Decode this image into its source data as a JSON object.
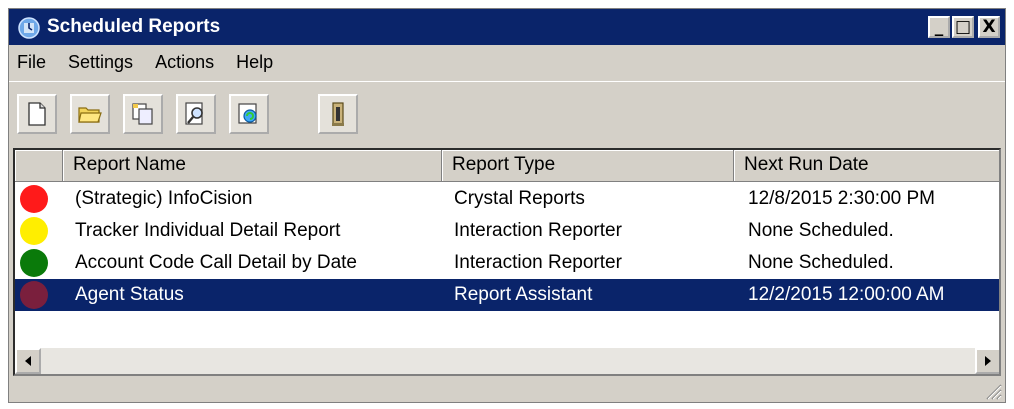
{
  "window": {
    "title": "Scheduled Reports",
    "buttons": {
      "minimize": "_",
      "maximize": "□",
      "close": "X"
    }
  },
  "menu": [
    "File",
    "Settings",
    "Actions",
    "Help"
  ],
  "toolbar": {
    "buttons": [
      {
        "icon": "new-document-icon"
      },
      {
        "icon": "open-folder-icon"
      },
      {
        "icon": "copy-icon"
      },
      {
        "icon": "find-icon"
      },
      {
        "icon": "refresh-icon"
      },
      {
        "icon": "properties-icon"
      }
    ]
  },
  "table": {
    "columns": [
      "Report Name",
      "Report Type",
      "Next Run Date"
    ],
    "rows": [
      {
        "status_color": "#ff1a1a",
        "name": "(Strategic) InfoCision",
        "type": "Crystal Reports",
        "next_run": "12/8/2015 2:30:00 PM",
        "selected": false
      },
      {
        "status_color": "#ffee00",
        "name": "Tracker Individual Detail Report",
        "type": "Interaction Reporter",
        "next_run": "None Scheduled.",
        "selected": false
      },
      {
        "status_color": "#0a7a0a",
        "name": "Account Code Call Detail by Date",
        "type": "Interaction Reporter",
        "next_run": "None Scheduled.",
        "selected": false
      },
      {
        "status_color": "#7a1f3d",
        "name": "Agent Status",
        "type": "Report Assistant",
        "next_run": "12/2/2015 12:00:00 AM",
        "selected": true
      }
    ]
  },
  "colors": {
    "title_bar": "#0a246a",
    "selection": "#0a246a",
    "chrome": "#d4d0c8"
  }
}
